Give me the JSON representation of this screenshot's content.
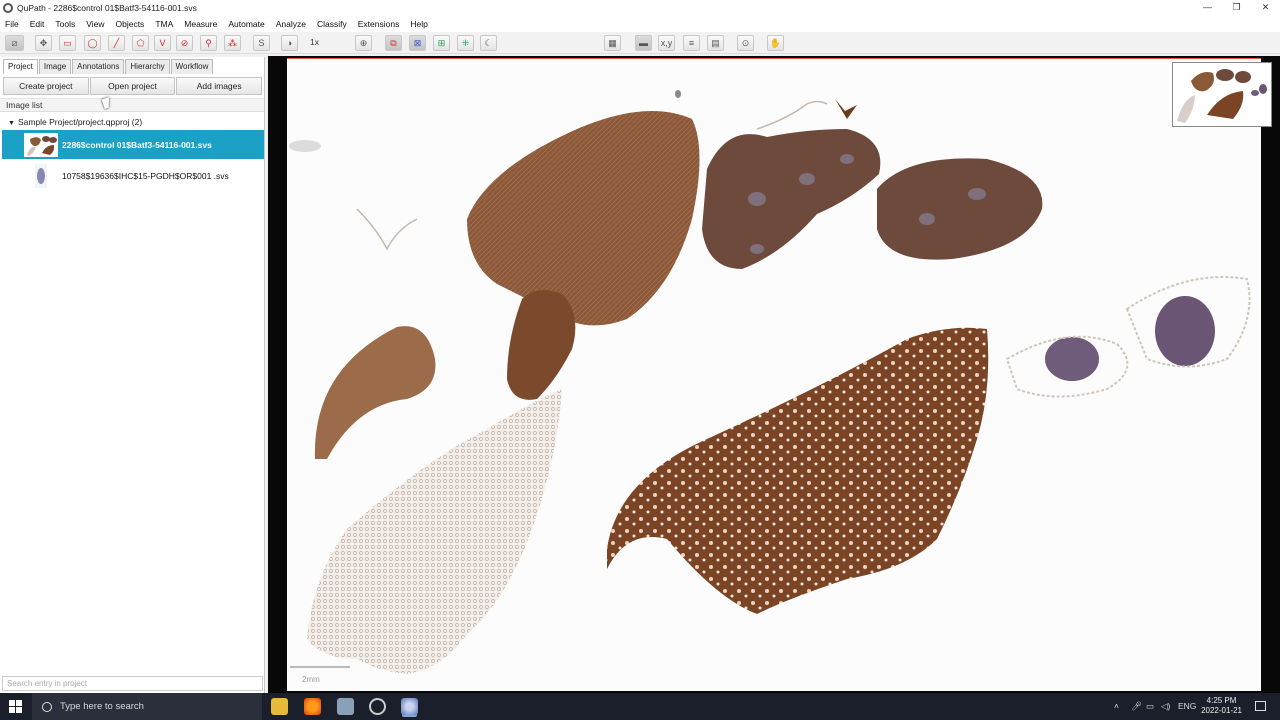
{
  "window": {
    "title": "QuPath - 2286$control 01$Batf3-54116-001.svs",
    "controls": [
      "—",
      "❐",
      "✕"
    ]
  },
  "menu": [
    "File",
    "Edit",
    "Tools",
    "View",
    "Objects",
    "TMA",
    "Measure",
    "Automate",
    "Analyze",
    "Classify",
    "Extensions",
    "Help"
  ],
  "toolbar": {
    "zoom_text": "1x",
    "icons": [
      "move-icon",
      "rectangle-icon",
      "ellipse-icon",
      "line-icon",
      "polygon-icon",
      "polyline-icon",
      "brush-icon",
      "wand-icon",
      "points-icon",
      "selection-mode-icon",
      "brightness-contrast-icon",
      "zoom-to-fit-icon",
      "show-annotations-icon",
      "fill-annotations-icon",
      "show-tma-grid-icon",
      "show-detections-icon",
      "fill-detections-icon",
      "opacity-icon",
      "grid-icon",
      "pixel-classification-icon",
      "cell-display-icon",
      "counting-grid-icon",
      "log-icon",
      "measurement-maps-icon"
    ]
  },
  "left_panel": {
    "tabs": [
      "Project",
      "Image",
      "Annotations",
      "Hierarchy",
      "Workflow"
    ],
    "active_tab": "Project",
    "buttons": {
      "create": "Create project",
      "open": "Open project",
      "add": "Add images"
    },
    "section_label": "Image list",
    "tree_root": "Sample Project/project.qpproj (2)",
    "entries": [
      {
        "name": "2286$control 01$Batf3-54116-001.svs",
        "selected": true
      },
      {
        "name": "10758$19636$IHC$15-PGDH$OR$001 .svs",
        "selected": false
      }
    ],
    "search_placeholder": "Search entry in project"
  },
  "viewer": {
    "scale_label": "2mm"
  },
  "taskbar": {
    "search_placeholder": "Type here to search",
    "language": "ENG",
    "time": "4:25 PM",
    "date": "2022-01-21"
  },
  "colors": {
    "selection": "#1ba1c5",
    "stain_dark": "#7a4a2a",
    "stain_light": "#b58c6e",
    "tissue_pale": "#d8cfc8"
  }
}
